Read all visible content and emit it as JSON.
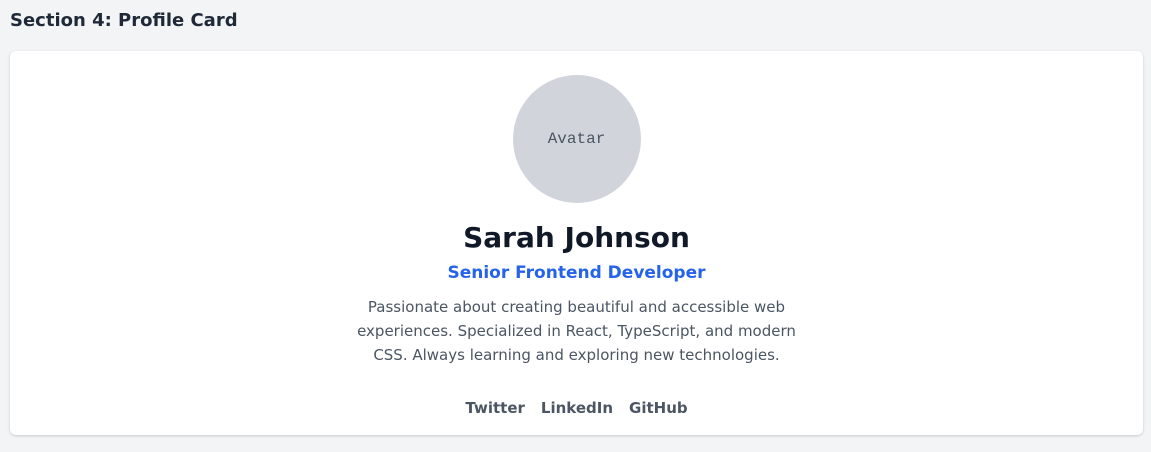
{
  "section": {
    "title": "Section 4: Profile Card"
  },
  "profile": {
    "avatar_label": "Avatar",
    "name": "Sarah Johnson",
    "role": "Senior Frontend Developer",
    "bio": "Passionate about creating beautiful and accessible web experiences. Specialized in React, TypeScript, and modern CSS. Always learning and exploring new technologies.",
    "links": [
      {
        "label": "Twitter"
      },
      {
        "label": "LinkedIn"
      },
      {
        "label": "GitHub"
      }
    ]
  },
  "colors": {
    "page_background": "#f3f4f6",
    "card_background": "#ffffff",
    "avatar_background": "#d1d5db",
    "role_accent": "#2563eb",
    "text_primary": "#111827",
    "text_secondary": "#4b5563"
  }
}
